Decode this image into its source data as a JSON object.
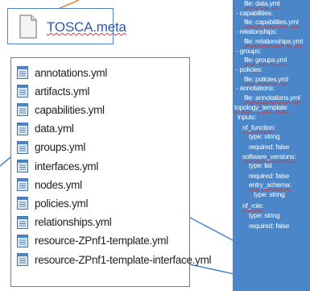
{
  "meta": {
    "label": "TOSCA.meta"
  },
  "files": [
    {
      "name": "annotations.yml"
    },
    {
      "name": "artifacts.yml"
    },
    {
      "name": "capabilities.yml"
    },
    {
      "name": "data.yml"
    },
    {
      "name": "groups.yml"
    },
    {
      "name": "interfaces.yml"
    },
    {
      "name": "nodes.yml"
    },
    {
      "name": "policies.yml"
    },
    {
      "name": "relationships.yml"
    },
    {
      "name": "resource-ZPnf1-template.yml"
    },
    {
      "name": "resource-ZPnf1-template-interface.yml"
    }
  ],
  "yaml_lines": [
    {
      "text": "file: data.yml"
    },
    {
      "text": "- capabilities:"
    },
    {
      "text": "file: capabilities.yml"
    },
    {
      "text": "- relationships:"
    },
    {
      "text": "file: relationships.yml"
    },
    {
      "text": "- groups:"
    },
    {
      "text": "file: groups.yml"
    },
    {
      "text": "- policies:"
    },
    {
      "text": "file: policies.yml"
    },
    {
      "text": "- annotations:"
    },
    {
      "text": "file: annotations.yml"
    },
    {
      "text": "topology_template:"
    },
    {
      "text": "inputs:"
    },
    {
      "text": "nf_function:"
    },
    {
      "text": "type: string"
    },
    {
      "text": "required: false"
    },
    {
      "text": "software_versions:"
    },
    {
      "text": "type: list"
    },
    {
      "text": "required: false"
    },
    {
      "text": "entry_schema:"
    },
    {
      "text": "type: string"
    },
    {
      "text": "nf_role:"
    },
    {
      "text": "type: string"
    },
    {
      "text": "required: false"
    }
  ],
  "colors": {
    "accent": "#4a86c8",
    "panel_text": "#ffffff",
    "spellcheck": "#d43a3a"
  }
}
